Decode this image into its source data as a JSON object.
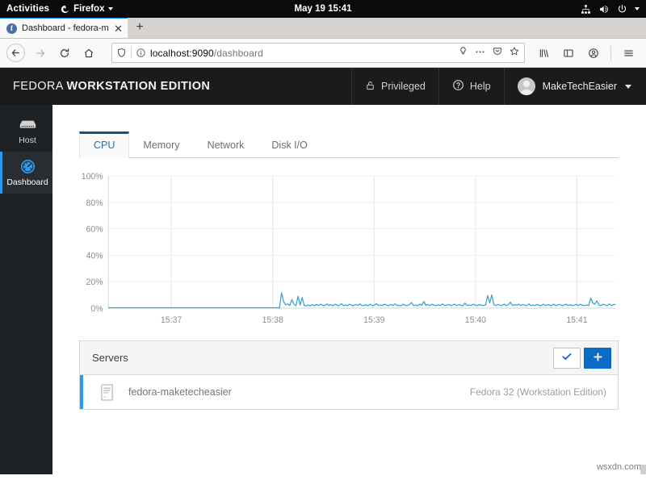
{
  "os_bar": {
    "activities": "Activities",
    "app_name": "Firefox",
    "app_icon": "firefox-icon",
    "clock": "May 19  15:41",
    "tray_icons": [
      "network-icon",
      "volume-icon",
      "power-icon",
      "caret-down-icon"
    ]
  },
  "browser": {
    "tab": {
      "title": "Dashboard - fedora-mak",
      "favicon": "firefox-favicon",
      "close_label": "✕"
    },
    "new_tab_label": "+",
    "nav": {
      "back_icon": "back-arrow-icon",
      "forward_icon": "forward-arrow-icon",
      "reload_icon": "reload-icon",
      "home_icon": "home-icon"
    },
    "urlbar": {
      "shield_icon": "shield-icon",
      "info_icon": "info-circle-icon",
      "url_host": "localhost:9090",
      "url_path": "/dashboard",
      "full_url": "localhost:9090/dashboard",
      "icons": [
        "lightbulb-icon",
        "ellipsis-icon",
        "pocket-icon",
        "star-icon"
      ]
    },
    "toolbar_icons": [
      "library-icon",
      "sidebar-icon",
      "account-icon",
      "hamburger-menu-icon"
    ]
  },
  "cockpit": {
    "brand_prefix": "FEDORA ",
    "brand_bold": "WORKSTATION EDITION",
    "header_items": [
      {
        "label": "Privileged",
        "icon": "unlock-icon"
      },
      {
        "label": "Help",
        "icon": "help-circle-icon"
      }
    ],
    "user": {
      "name": "MakeTechEasier",
      "avatar": "user-avatar",
      "caret": "caret-down-icon"
    },
    "sidebar": {
      "items": [
        {
          "label": "Host",
          "icon": "server-icon",
          "active": false
        },
        {
          "label": "Dashboard",
          "icon": "dashboard-gauge-icon",
          "active": true
        }
      ]
    },
    "tabs": [
      {
        "label": "CPU",
        "active": true
      },
      {
        "label": "Memory",
        "active": false
      },
      {
        "label": "Network",
        "active": false
      },
      {
        "label": "Disk I/O",
        "active": false
      }
    ],
    "servers_panel": {
      "title": "Servers",
      "check_button_icon": "check-icon",
      "add_button_icon": "plus-icon",
      "rows": [
        {
          "icon": "server-rack-icon",
          "name": "fedora-maketecheasier",
          "os": "Fedora 32 (Workstation Edition)"
        }
      ]
    },
    "accent_color": "#2b9af3",
    "primary_button_color": "#0a6cc4"
  },
  "watermark": "wsxdn.com",
  "chart_data": {
    "type": "line",
    "title": "",
    "xlabel": "",
    "ylabel": "",
    "ylim": [
      0,
      100
    ],
    "ytick_labels": [
      "0%",
      "20%",
      "40%",
      "60%",
      "80%",
      "100%"
    ],
    "yticks": [
      0,
      20,
      40,
      60,
      80,
      100
    ],
    "xtick_labels": [
      "15:37",
      "15:38",
      "15:39",
      "15:40",
      "15:41"
    ],
    "xticks": [
      15.617,
      15.633,
      15.65,
      15.667,
      15.683
    ],
    "grid": true,
    "legend": "none",
    "series": [
      {
        "name": "CPU",
        "color": "#3aa0d1",
        "values": [
          0.3,
          0.3,
          0.3,
          0.3,
          0.3,
          0.3,
          0.3,
          0.3,
          0.3,
          0.3,
          0.3,
          0.3,
          0.3,
          0.3,
          0.3,
          0.3,
          0.3,
          0.3,
          0.3,
          0.3,
          0.3,
          0.3,
          0.3,
          0.3,
          0.3,
          0.3,
          0.3,
          0.3,
          0.3,
          0.3,
          0.3,
          0.3,
          0.3,
          0.3,
          0.3,
          0.3,
          0.3,
          0.3,
          0.3,
          0.3,
          0.3,
          0.3,
          0.3,
          0.3,
          0.3,
          0.3,
          0.3,
          0.3,
          0.3,
          0.3,
          0.3,
          0.3,
          0.3,
          0.3,
          0.3,
          0.3,
          0.3,
          0.3,
          0.3,
          0.3,
          0.3,
          0.3,
          0.3,
          0.3,
          0.3,
          0.3,
          0.3,
          0.3,
          0.3,
          0.3,
          0.3,
          0.3,
          0.3,
          0.3,
          0.3,
          0.3,
          0.3,
          0.3,
          0.3,
          0.3,
          0.3,
          0.3,
          0.3,
          0.3,
          11.5,
          5.0,
          2.5,
          3.2,
          2.0,
          6.5,
          3.0,
          1.8,
          9.0,
          2.2,
          8.0,
          2.0,
          1.6,
          2.4,
          1.8,
          2.6,
          1.9,
          2.8,
          2.0,
          3.0,
          2.1,
          2.0,
          3.2,
          2.0,
          2.6,
          1.8,
          3.0,
          2.2,
          2.0,
          3.4,
          2.0,
          2.4,
          1.9,
          3.0,
          2.2,
          2.0,
          2.8,
          2.0,
          3.2,
          2.1,
          2.0,
          2.6,
          1.8,
          3.0,
          2.0,
          2.2,
          3.4,
          2.0,
          2.4,
          2.0,
          3.0,
          2.2,
          1.9,
          2.8,
          2.0,
          3.2,
          2.0,
          2.2,
          1.8,
          3.0,
          2.1,
          2.0,
          2.6,
          4.2,
          2.0,
          2.4,
          1.8,
          3.0,
          2.2,
          5.0,
          2.0,
          2.8,
          2.0,
          3.0,
          2.2,
          1.9,
          2.6,
          2.0,
          3.2,
          2.0,
          2.2,
          2.8,
          2.0,
          2.4,
          3.0,
          2.0,
          2.6,
          2.2,
          1.9,
          3.8,
          2.0,
          2.4,
          2.0,
          3.0,
          2.2,
          2.0,
          2.8,
          2.1,
          2.0,
          2.6,
          9.5,
          4.0,
          10.0,
          2.5,
          2.0,
          2.8,
          2.2,
          2.0,
          3.0,
          2.0,
          2.4,
          4.5,
          2.0,
          2.6,
          2.2,
          3.0,
          2.0,
          2.8,
          2.2,
          2.0,
          3.2,
          2.0,
          2.4,
          2.0,
          2.8,
          2.2,
          1.9,
          3.0,
          2.0,
          2.6,
          2.2,
          2.0,
          3.0,
          2.0,
          2.4,
          2.8,
          2.0,
          2.2,
          3.0,
          2.0,
          2.6,
          2.0,
          2.2,
          2.8,
          2.0,
          3.0,
          2.2,
          2.0,
          2.4,
          2.0,
          7.5,
          4.0,
          3.0,
          5.5,
          2.2,
          2.0,
          3.0,
          2.4,
          2.0,
          3.2,
          2.0,
          2.6,
          3.0
        ]
      }
    ]
  }
}
